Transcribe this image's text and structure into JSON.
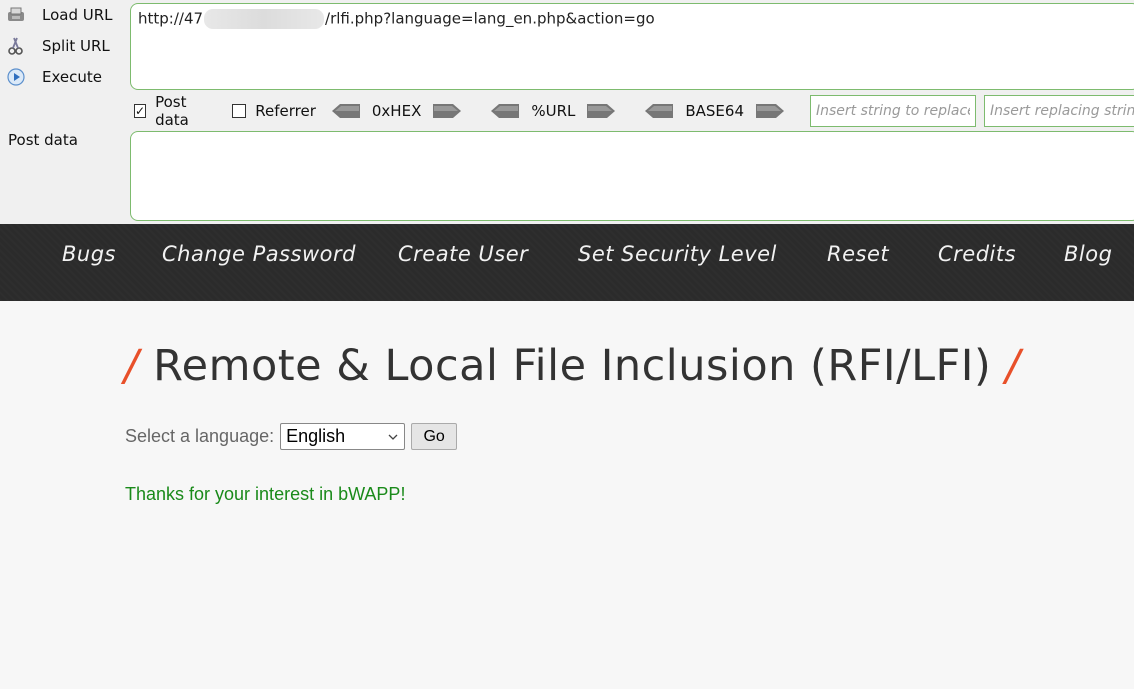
{
  "hackbar": {
    "actions": [
      {
        "label": "Load URL",
        "icon": "load-url-icon"
      },
      {
        "label": "Split URL",
        "icon": "split-url-icon"
      },
      {
        "label": "Execute",
        "icon": "execute-icon"
      }
    ],
    "url_prefix": "http://47",
    "url_suffix": "/rlfi.php?language=lang_en.php&action=go",
    "options": {
      "post_data_label": "Post data",
      "post_data_checked": true,
      "referrer_label": "Referrer",
      "referrer_checked": false,
      "encoders": [
        "0xHEX",
        "%URL",
        "BASE64"
      ]
    },
    "replace_placeholder": "Insert string to replace",
    "replacing_placeholder": "Insert replacing string",
    "post_data_field_label": "Post data",
    "post_data_value": ""
  },
  "nav": {
    "items": [
      "Bugs",
      "Change Password",
      "Create User",
      "Set Security Level",
      "Reset",
      "Credits",
      "Blog"
    ]
  },
  "main": {
    "title": "Remote & Local File Inclusion (RFI/LFI)",
    "slash": "/",
    "select_label": "Select a language:",
    "selected_language": "English",
    "go_label": "Go",
    "message": "Thanks for your interest in bWAPP!"
  },
  "colors": {
    "accent_slash": "#e8502a",
    "message_green": "#1a8a1a",
    "field_border": "#7dbb6e",
    "nav_bg": "#2b2b2b"
  }
}
